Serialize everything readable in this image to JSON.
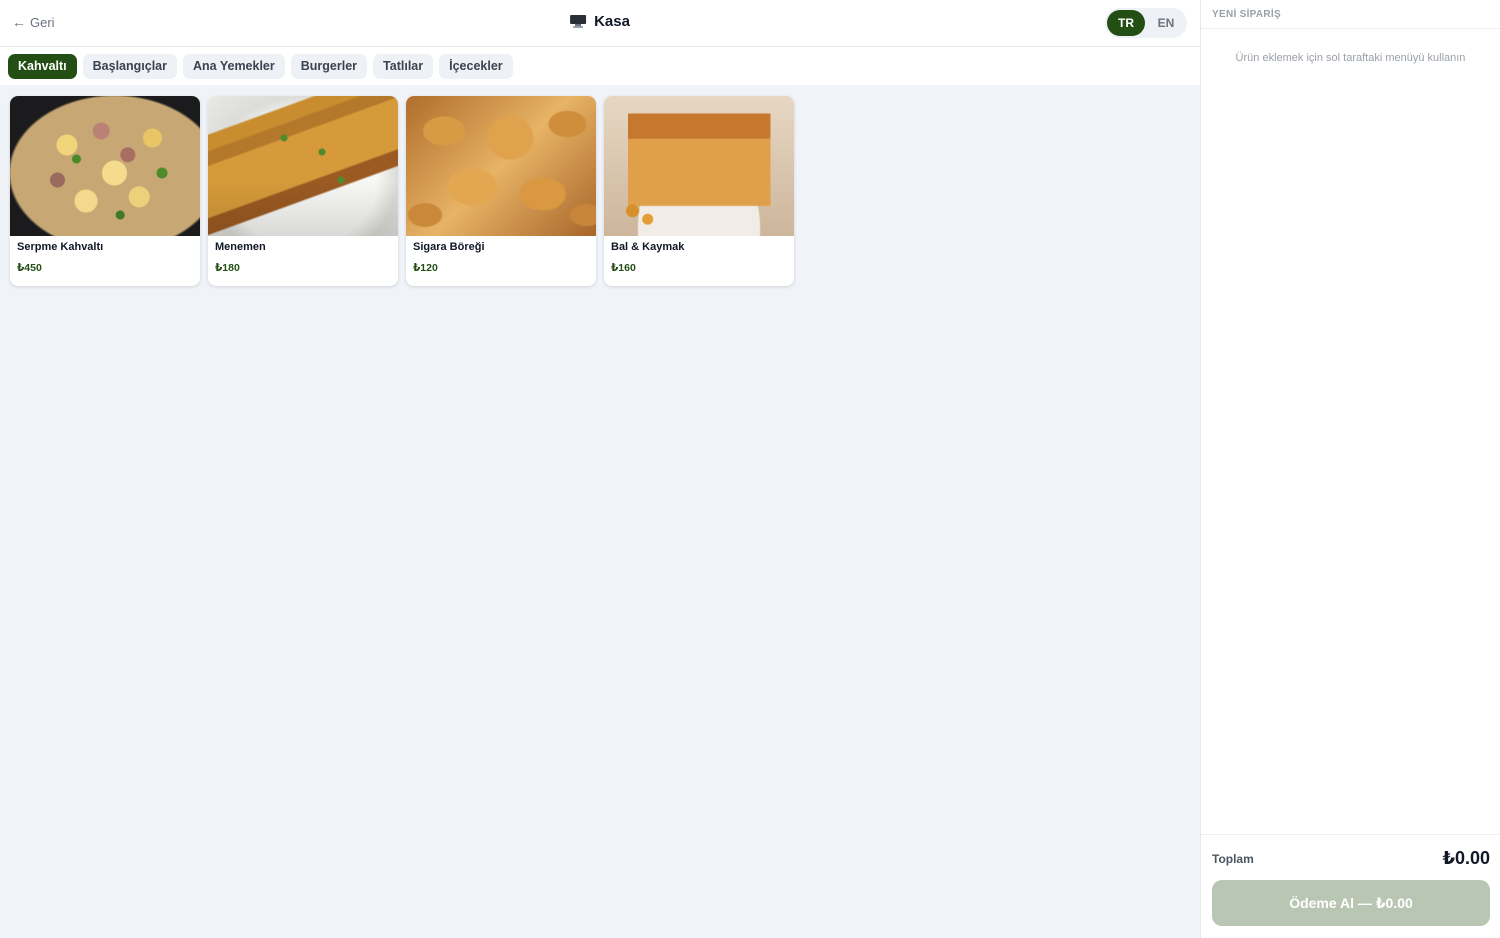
{
  "header": {
    "back_label": "Geri",
    "back_arrow": "←",
    "title": "Kasa",
    "title_icon": "monitor-icon",
    "languages": [
      {
        "label": "TR",
        "active": true
      },
      {
        "label": "EN",
        "active": false
      }
    ]
  },
  "categories": [
    {
      "label": "Kahvaltı",
      "active": true
    },
    {
      "label": "Başlangıçlar",
      "active": false
    },
    {
      "label": "Ana Yemekler",
      "active": false
    },
    {
      "label": "Burgerler",
      "active": false
    },
    {
      "label": "Tatlılar",
      "active": false
    },
    {
      "label": "İçecekler",
      "active": false
    }
  ],
  "products": [
    {
      "name": "Serpme Kahvaltı",
      "price": "₺450"
    },
    {
      "name": "Menemen",
      "price": "₺180"
    },
    {
      "name": "Sigara Böreği",
      "price": "₺120"
    },
    {
      "name": "Bal & Kaymak",
      "price": "₺160"
    }
  ],
  "order": {
    "title": "YENİ SİPARİŞ",
    "empty_message": "Ürün eklemek için sol taraftaki menüyü kullanın",
    "total_label": "Toplam",
    "total_value": "₺0.00",
    "pay_button": "Ödeme Al — ₺0.00"
  },
  "colors": {
    "accent": "#234f14",
    "pay_disabled": "#b9c6b3",
    "background": "#f0f3f8"
  }
}
